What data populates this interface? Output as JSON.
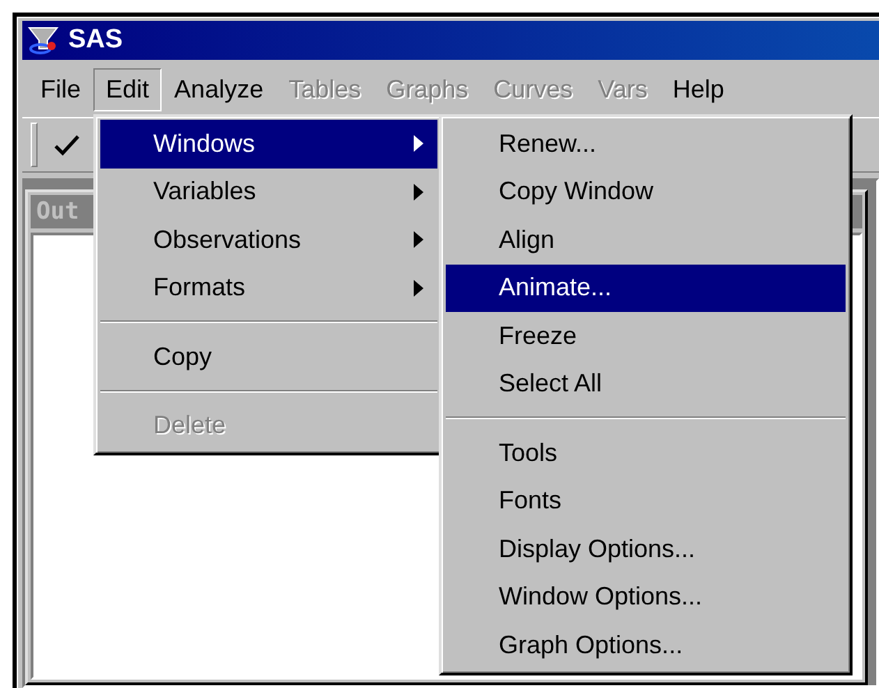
{
  "window": {
    "title": "SAS"
  },
  "menu_bar": [
    {
      "label": "File",
      "disabled": false,
      "selected": false
    },
    {
      "label": "Edit",
      "disabled": false,
      "selected": true
    },
    {
      "label": "Analyze",
      "disabled": false,
      "selected": false
    },
    {
      "label": "Tables",
      "disabled": true,
      "selected": false
    },
    {
      "label": "Graphs",
      "disabled": true,
      "selected": false
    },
    {
      "label": "Curves",
      "disabled": true,
      "selected": false
    },
    {
      "label": "Vars",
      "disabled": true,
      "selected": false
    },
    {
      "label": "Help",
      "disabled": false,
      "selected": false
    }
  ],
  "output_window": {
    "title": "Out"
  },
  "edit_menu": [
    {
      "kind": "item",
      "label": "Windows",
      "submenu": true,
      "disabled": false,
      "selected": true
    },
    {
      "kind": "item",
      "label": "Variables",
      "submenu": true,
      "disabled": false,
      "selected": false
    },
    {
      "kind": "item",
      "label": "Observations",
      "submenu": true,
      "disabled": false,
      "selected": false
    },
    {
      "kind": "item",
      "label": "Formats",
      "submenu": true,
      "disabled": false,
      "selected": false
    },
    {
      "kind": "separator"
    },
    {
      "kind": "item",
      "label": "Copy",
      "submenu": false,
      "disabled": false,
      "selected": false
    },
    {
      "kind": "separator"
    },
    {
      "kind": "item",
      "label": "Delete",
      "submenu": false,
      "disabled": true,
      "selected": false
    }
  ],
  "windows_submenu": [
    {
      "kind": "item",
      "label": "Renew...",
      "submenu": false,
      "disabled": false,
      "selected": false
    },
    {
      "kind": "item",
      "label": "Copy Window",
      "submenu": false,
      "disabled": false,
      "selected": false
    },
    {
      "kind": "item",
      "label": "Align",
      "submenu": false,
      "disabled": false,
      "selected": false
    },
    {
      "kind": "item",
      "label": "Animate...",
      "submenu": false,
      "disabled": false,
      "selected": true
    },
    {
      "kind": "item",
      "label": "Freeze",
      "submenu": false,
      "disabled": false,
      "selected": false
    },
    {
      "kind": "item",
      "label": "Select All",
      "submenu": false,
      "disabled": false,
      "selected": false
    },
    {
      "kind": "separator"
    },
    {
      "kind": "item",
      "label": "Tools",
      "submenu": false,
      "disabled": false,
      "selected": false
    },
    {
      "kind": "item",
      "label": "Fonts",
      "submenu": false,
      "disabled": false,
      "selected": false
    },
    {
      "kind": "item",
      "label": "Display Options...",
      "submenu": false,
      "disabled": false,
      "selected": false
    },
    {
      "kind": "item",
      "label": "Window Options...",
      "submenu": false,
      "disabled": false,
      "selected": false
    },
    {
      "kind": "item",
      "label": "Graph Options...",
      "submenu": false,
      "disabled": false,
      "selected": false
    }
  ]
}
